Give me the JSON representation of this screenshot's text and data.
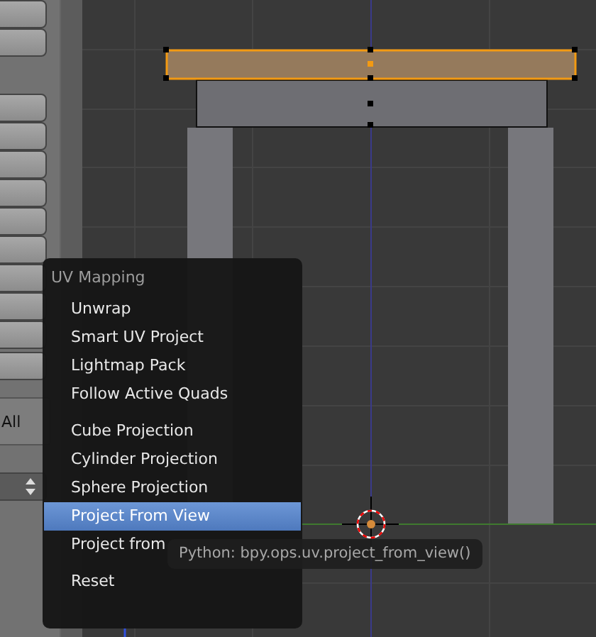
{
  "side_panel": {
    "label": "All"
  },
  "menu": {
    "title": "UV Mapping",
    "sections": [
      [
        {
          "label": "Unwrap",
          "selected": false
        },
        {
          "label": "Smart UV Project",
          "selected": false
        },
        {
          "label": "Lightmap Pack",
          "selected": false
        },
        {
          "label": "Follow Active Quads",
          "selected": false
        }
      ],
      [
        {
          "label": "Cube Projection",
          "selected": false
        },
        {
          "label": "Cylinder Projection",
          "selected": false
        },
        {
          "label": "Sphere Projection",
          "selected": false
        },
        {
          "label": "Project From View",
          "selected": true
        },
        {
          "label": "Project from",
          "selected": false
        }
      ],
      [
        {
          "label": "Reset",
          "selected": false
        }
      ]
    ]
  },
  "tooltip": {
    "text": "Python: bpy.ops.uv.project_from_view()"
  }
}
